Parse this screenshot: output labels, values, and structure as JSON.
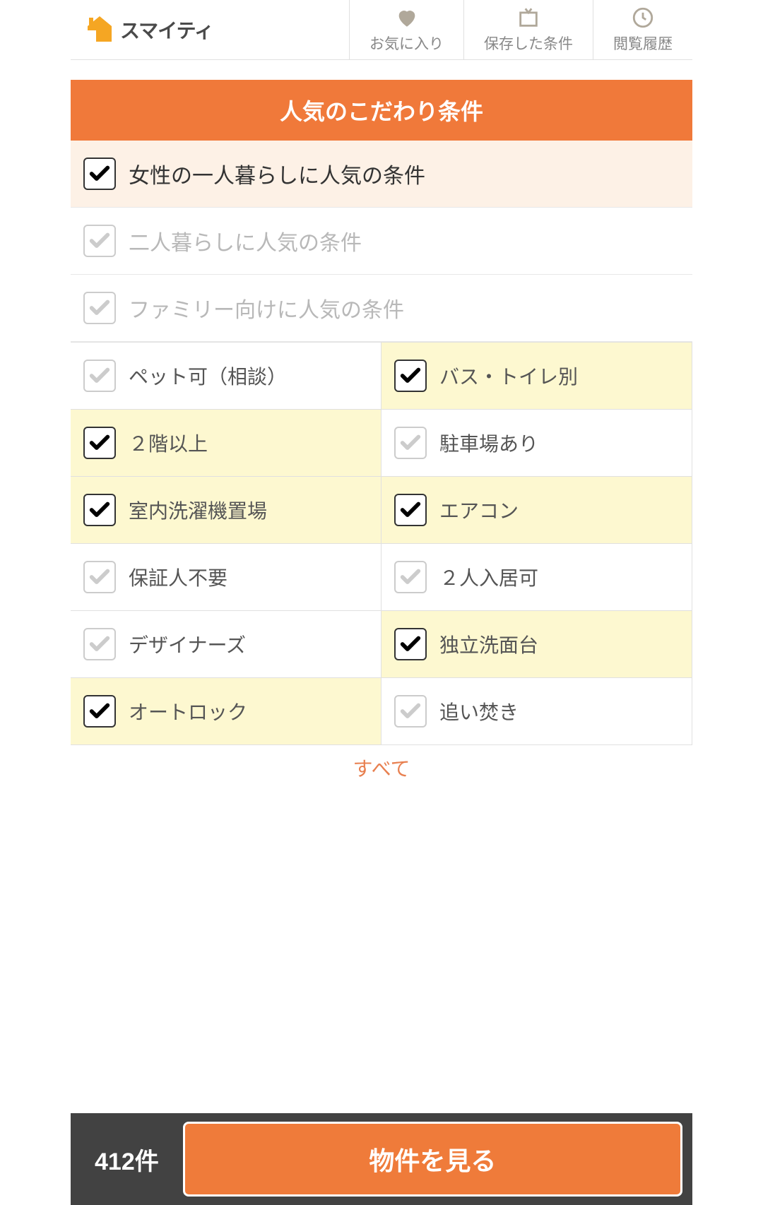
{
  "header": {
    "logo_text": "スマイティ",
    "nav": {
      "favorites": "お気に入り",
      "saved": "保存した条件",
      "history": "閲覧履歴"
    }
  },
  "section_title": "人気のこだわり条件",
  "presets": [
    {
      "label": "女性の一人暮らしに人気の条件",
      "checked": true,
      "disabled": false
    },
    {
      "label": "二人暮らしに人気の条件",
      "checked": false,
      "disabled": true
    },
    {
      "label": "ファミリー向けに人気の条件",
      "checked": false,
      "disabled": true
    }
  ],
  "options": [
    {
      "label": "ペット可（相談）",
      "checked": false
    },
    {
      "label": "バス・トイレ別",
      "checked": true
    },
    {
      "label": "２階以上",
      "checked": true
    },
    {
      "label": "駐車場あり",
      "checked": false
    },
    {
      "label": "室内洗濯機置場",
      "checked": true
    },
    {
      "label": "エアコン",
      "checked": true
    },
    {
      "label": "保証人不要",
      "checked": false
    },
    {
      "label": "２人入居可",
      "checked": false
    },
    {
      "label": "デザイナーズ",
      "checked": false
    },
    {
      "label": "独立洗面台",
      "checked": true
    },
    {
      "label": "オートロック",
      "checked": true
    },
    {
      "label": "追い焚き",
      "checked": false
    }
  ],
  "expand_hint": "すべて",
  "footer": {
    "count": "412件",
    "button": "物件を見る"
  }
}
